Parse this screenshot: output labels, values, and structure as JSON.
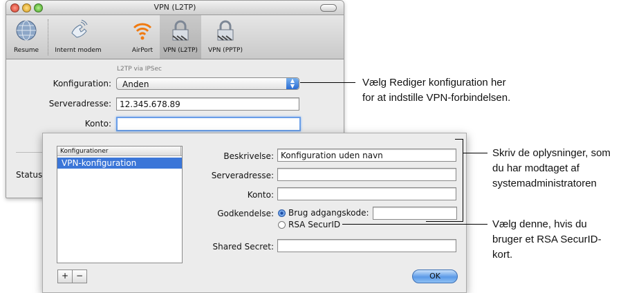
{
  "window": {
    "title": "VPN (L2TP)",
    "toolbar": [
      {
        "label": "Resume",
        "icon": "globe-icon"
      },
      {
        "label": "Internt modem",
        "icon": "phone-icon"
      },
      {
        "label": "AirPort",
        "icon": "airport-icon"
      },
      {
        "label": "VPN (L2TP)",
        "icon": "lock-icon",
        "selected": true
      },
      {
        "label": "VPN (PPTP)",
        "icon": "lock-icon"
      }
    ],
    "subtitle": "L2TP via IPSec",
    "config_label": "Konfiguration:",
    "config_value": "Anden",
    "server_label": "Serveradresse:",
    "server_value": "12.345.678.89",
    "account_label": "Konto:",
    "account_value": "",
    "status_label": "Status"
  },
  "sheet": {
    "list_header": "Konfigurationer",
    "list_items": [
      "VPN-konfiguration"
    ],
    "desc_label": "Beskrivelse:",
    "desc_value": "Konfiguration uden navn",
    "server_label": "Serveradresse:",
    "server_value": "",
    "account_label": "Konto:",
    "account_value": "",
    "auth_label": "Godkendelse:",
    "auth_option1": "Brug adgangskode:",
    "auth_option2": "RSA SecurID",
    "password_value": "",
    "secret_label": "Shared Secret:",
    "secret_value": "",
    "plus": "+",
    "minus": "−",
    "ok": "OK"
  },
  "callouts": {
    "c1_line1": "Vælg Rediger konfiguration her",
    "c1_line2": "for at indstille VPN-forbindelsen.",
    "c2_line1": "Skriv de oplysninger, som",
    "c2_line2": "du har modtaget af",
    "c2_line3": "systemadministratoren",
    "c3_line1": "Vælg denne, hvis du",
    "c3_line2": "bruger et RSA SecurID-",
    "c3_line3": "kort."
  },
  "colors": {
    "selection": "#3b76d8",
    "focus": "#6a9ee8",
    "ok_button": "#5b9ae7"
  }
}
